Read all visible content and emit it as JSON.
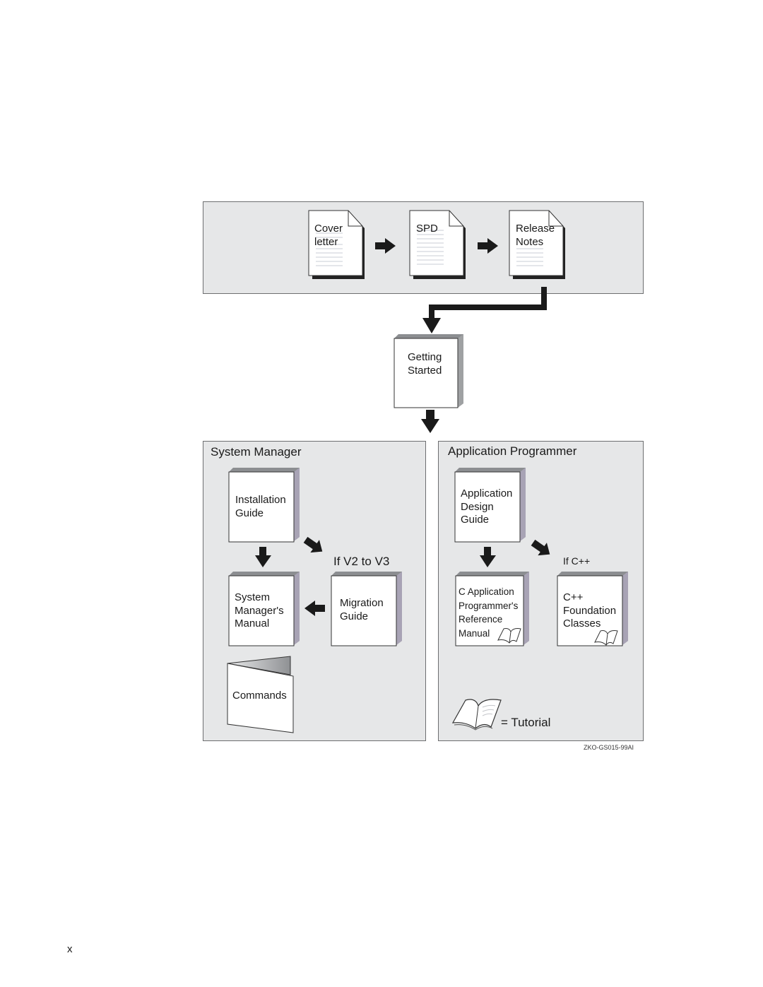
{
  "figure": {
    "id": "ZKO-GS015-99AI",
    "page_number": "x"
  },
  "top_panel": {
    "documents": [
      {
        "label": "Cover\nletter",
        "icon": "document-icon"
      },
      {
        "label": "SPD",
        "icon": "document-icon"
      },
      {
        "label": "Release\nNotes",
        "icon": "document-icon"
      }
    ]
  },
  "getting_started": {
    "label": "Getting\nStarted",
    "icon": "book-icon"
  },
  "system_manager": {
    "title": "System Manager",
    "condition_label": "If V2 to V3",
    "books": [
      {
        "label": "Installation\nGuide"
      },
      {
        "label": "System\nManager's\nManual"
      },
      {
        "label": "Migration\nGuide"
      }
    ],
    "pamphlet": {
      "label": "Commands"
    }
  },
  "application_programmer": {
    "title": "Application Programmer",
    "condition_label": "If C++",
    "books": [
      {
        "label": "Application\nDesign\nGuide",
        "tutorial": false
      },
      {
        "label": "C Application\nProgrammer's\nReference\nManual",
        "tutorial": true
      },
      {
        "label": "C++\nFoundation\nClasses",
        "tutorial": true
      }
    ],
    "legend": {
      "icon": "open-book-icon",
      "text": "= Tutorial"
    }
  },
  "colors": {
    "panel_bg": "#e6e7e8",
    "panel_border": "#6d6e70",
    "arrow": "#1a1a1a",
    "page": "#ffffff"
  }
}
